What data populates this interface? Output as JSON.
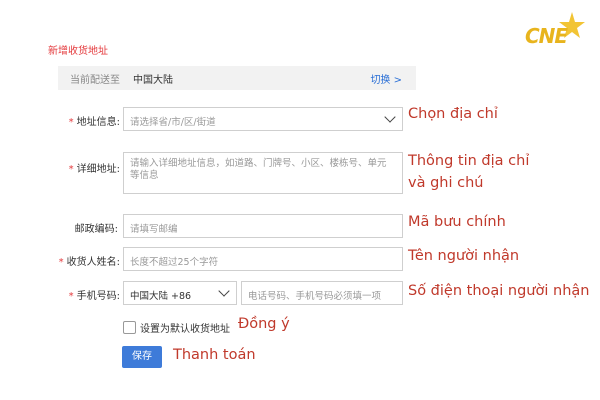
{
  "title": "新增收货地址",
  "ship_bar": {
    "prefix": "当前配送至",
    "region": "中国大陆",
    "switch_label": "切换 >"
  },
  "form": {
    "address": {
      "label": "地址信息:",
      "placeholder": "请选择省/市/区/街道"
    },
    "detail": {
      "label": "详细地址:",
      "placeholder": "请输入详细地址信息，如道路、门牌号、小区、楼栋号、单元等信息"
    },
    "postcode": {
      "label": "邮政编码:",
      "placeholder": "请填写邮编"
    },
    "name": {
      "label": "收货人姓名:",
      "placeholder": "长度不超过25个字符"
    },
    "phone": {
      "label": "手机号码:",
      "country_code": "中国大陆 +86",
      "placeholder": "电话号码、手机号码必须填一项"
    },
    "default_checkbox_label": "设置为默认收货地址",
    "save_label": "保存"
  },
  "annotations": {
    "address": "Chọn địa chỉ",
    "detail_line1": "Thông tin địa chỉ",
    "detail_line2": "và ghi chú",
    "postcode": "Mã bưu chính",
    "name": "Tên người nhận",
    "phone": "Số điện thoại người nhận",
    "checkbox": "Đồng ý",
    "save": "Thanh toán"
  },
  "logo": {
    "text": "CNE"
  },
  "colors": {
    "accent_red": "#e4393c",
    "link_blue": "#2a6fd6",
    "button_blue": "#3e7bd9",
    "annotation_red": "#c0392b",
    "logo_gold": "#e8b41d"
  }
}
